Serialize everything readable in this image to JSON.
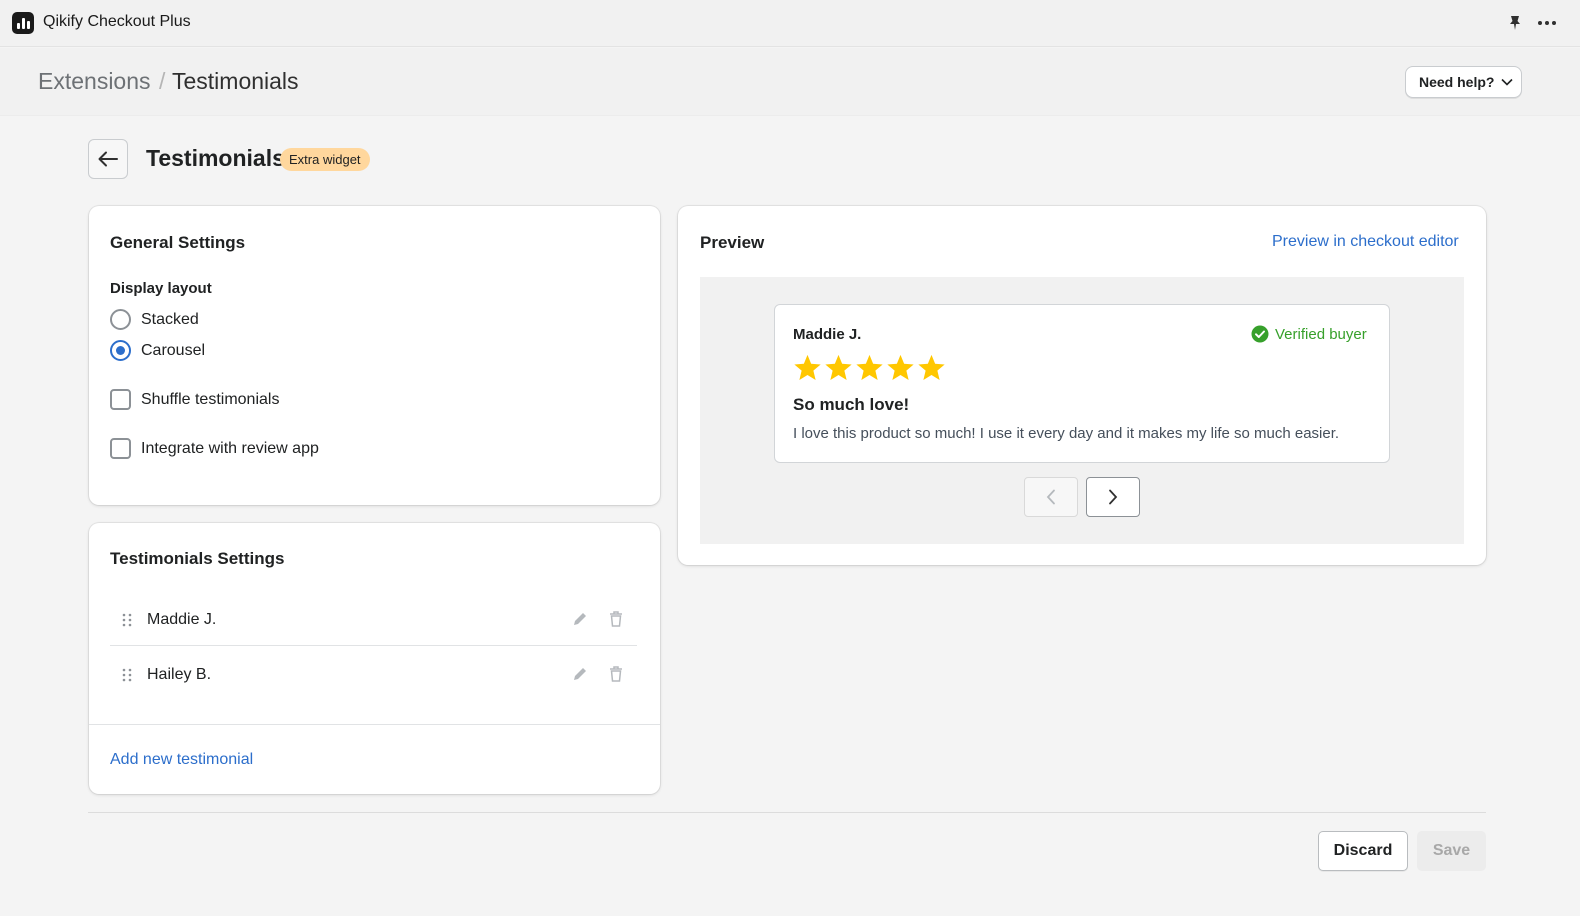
{
  "app": {
    "title": "Qikify Checkout Plus"
  },
  "breadcrumb": {
    "parent": "Extensions",
    "separator": "/",
    "current": "Testimonials"
  },
  "help_button": {
    "label": "Need help?"
  },
  "page": {
    "title": "Testimonials",
    "badge": "Extra widget"
  },
  "general_settings": {
    "title": "General Settings",
    "display_layout_label": "Display layout",
    "layout_options": [
      {
        "label": "Stacked",
        "selected": false
      },
      {
        "label": "Carousel",
        "selected": true
      }
    ],
    "shuffle_label": "Shuffle testimonials",
    "shuffle_checked": false,
    "integrate_label": "Integrate with review app",
    "integrate_checked": false
  },
  "testimonials_settings": {
    "title": "Testimonials Settings",
    "items": [
      {
        "name": "Maddie J."
      },
      {
        "name": "Hailey B."
      }
    ],
    "add_label": "Add new testimonial"
  },
  "preview": {
    "title": "Preview",
    "link_label": "Preview in checkout editor",
    "review": {
      "author": "Maddie J.",
      "verified_label": "Verified buyer",
      "rating": 5,
      "title": "So much love!",
      "body": "I love this product so much! I use it every day and it makes my life so much easier."
    }
  },
  "footer": {
    "discard_label": "Discard",
    "save_label": "Save"
  },
  "colors": {
    "accent": "#2c6ecb",
    "star": "#ffc700",
    "verified": "#37a02b",
    "badge": "#ffd79d"
  }
}
